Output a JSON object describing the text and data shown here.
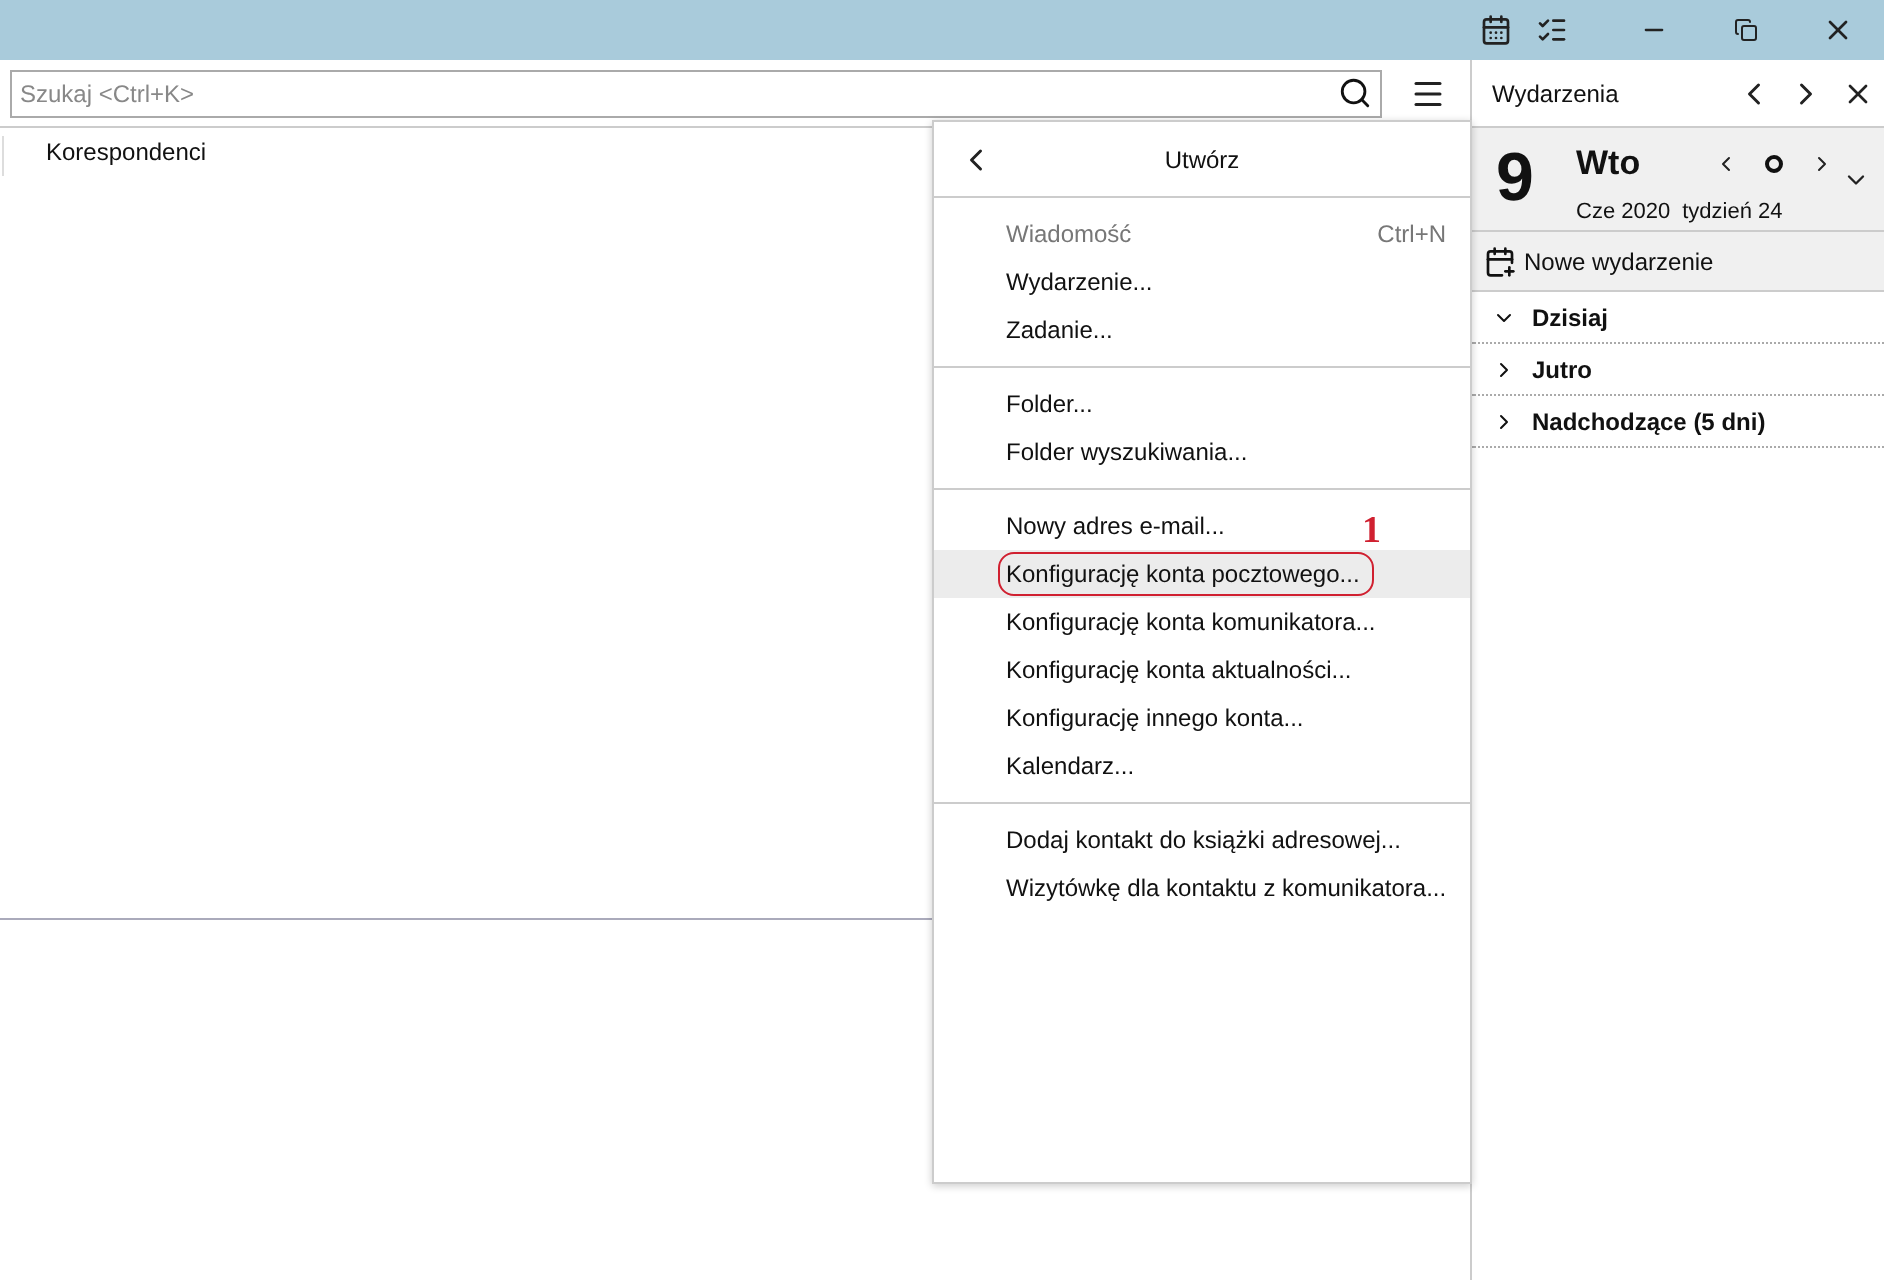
{
  "search": {
    "placeholder": "Szukaj <Ctrl+K>"
  },
  "list": {
    "column_header": "Korespondenci"
  },
  "menu": {
    "title": "Utwórz",
    "groups": [
      [
        {
          "label": "Wiadomość",
          "shortcut": "Ctrl+N",
          "disabled": true,
          "selected": false
        },
        {
          "label": "Wydarzenie...",
          "disabled": false,
          "selected": false
        },
        {
          "label": "Zadanie...",
          "disabled": false,
          "selected": false
        }
      ],
      [
        {
          "label": "Folder...",
          "disabled": false,
          "selected": false
        },
        {
          "label": "Folder wyszukiwania...",
          "disabled": false,
          "selected": false
        }
      ],
      [
        {
          "label": "Nowy adres e-mail...",
          "disabled": false,
          "selected": false
        },
        {
          "label": "Konfigurację konta pocztowego...",
          "disabled": false,
          "selected": true,
          "annotation": "1"
        },
        {
          "label": "Konfigurację konta komunikatora...",
          "disabled": false,
          "selected": false
        },
        {
          "label": "Konfigurację konta aktualności...",
          "disabled": false,
          "selected": false
        },
        {
          "label": "Konfigurację innego konta...",
          "disabled": false,
          "selected": false
        },
        {
          "label": "Kalendarz...",
          "disabled": false,
          "selected": false
        }
      ],
      [
        {
          "label": "Dodaj kontakt do książki adresowej...",
          "disabled": false,
          "selected": false
        },
        {
          "label": "Wizytówkę dla kontaktu z komunikatora...",
          "disabled": false,
          "selected": false
        }
      ]
    ]
  },
  "sidebar": {
    "title": "Wydarzenia",
    "day": "9",
    "weekday": "Wto",
    "month_year": "Cze 2020",
    "week": "tydzień 24",
    "new_event": "Nowe wydarzenie",
    "sections": [
      {
        "label": "Dzisiaj",
        "expanded": true
      },
      {
        "label": "Jutro",
        "expanded": false
      },
      {
        "label": "Nadchodzące (5 dni)",
        "expanded": false
      }
    ]
  }
}
